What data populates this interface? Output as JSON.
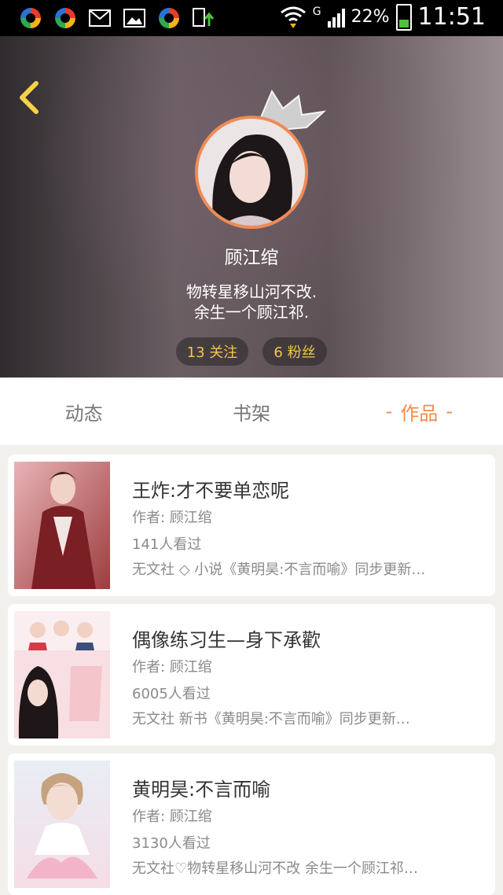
{
  "status_bar": {
    "network": "G",
    "battery_percent": "22%",
    "time": "11:51"
  },
  "profile": {
    "name": "顾江绾",
    "bio_line1": "物转星移山河不改.",
    "bio_line2": "余生一个顾江祁.",
    "follow_label": "13 关注",
    "fans_label": "6 粉丝"
  },
  "tabs": [
    {
      "label": "动态",
      "active": false
    },
    {
      "label": "书架",
      "active": false
    },
    {
      "label": "作品",
      "active": true,
      "dash": "-"
    }
  ],
  "works": [
    {
      "title": "王炸:才不要单恋呢",
      "author": "作者: 顾江绾",
      "views": "141人看过",
      "desc": "无文社 ◇ 小说《黄明昊:不言而喻》同步更新…"
    },
    {
      "title": "偶像练习生—身下承歡",
      "author": "作者: 顾江绾",
      "views": "6005人看过",
      "desc": "无文社 新书《黄明昊:不言而喻》同步更新…"
    },
    {
      "title": "黄明昊:不言而喻",
      "author": "作者: 顾江绾",
      "views": "3130人看过",
      "desc": "无文社♡物转星移山河不改 余生一个顾江祁…"
    }
  ],
  "colors": {
    "accent": "#f18d4e",
    "pill_text": "#f6c54b",
    "back_icon": "#f5d24a"
  }
}
